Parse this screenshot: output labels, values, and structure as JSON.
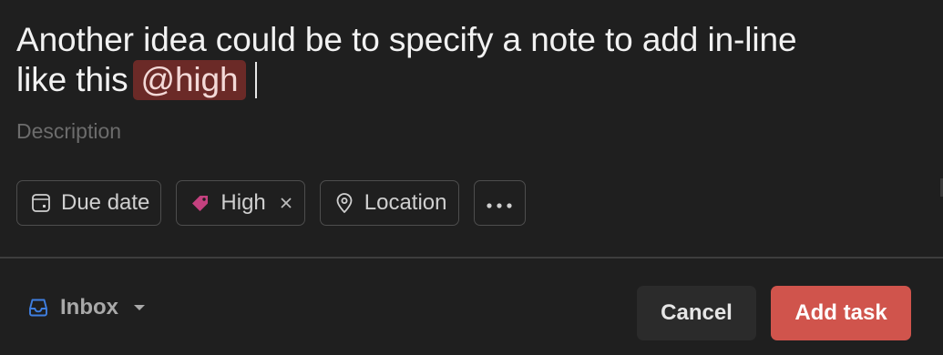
{
  "task": {
    "title_line1": "Another idea could be to specify a note to add in-line",
    "title_line2_prefix": "like this",
    "mention": "@high",
    "description_placeholder": "Description"
  },
  "chips": {
    "due_date": "Due date",
    "priority": "High",
    "location": "Location",
    "more": "···"
  },
  "footer": {
    "project": "Inbox",
    "cancel_label": "Cancel",
    "add_label": "Add task"
  },
  "colors": {
    "background": "#1f1f1f",
    "mention_bg": "#6b2a27",
    "priority_tag": "#c4417f",
    "inbox_icon": "#3f7fe0",
    "add_button": "#d0544c",
    "cancel_button": "#2b2b2b"
  },
  "icons": {
    "due_date": "calendar-icon",
    "priority": "tag-icon",
    "remove": "close-icon",
    "location": "location-pin-icon",
    "more": "more-dots-icon",
    "project": "inbox-icon",
    "project_dropdown": "chevron-down-icon"
  }
}
